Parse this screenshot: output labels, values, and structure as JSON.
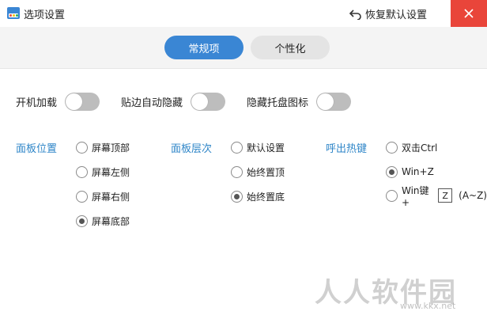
{
  "window": {
    "title": "选项设置",
    "restore_label": "恢复默认设置",
    "accent_color": "#3a86d4",
    "close_color": "#e9453a"
  },
  "tabs": [
    {
      "label": "常规项",
      "active": true
    },
    {
      "label": "个性化",
      "active": false
    }
  ],
  "toggles": [
    {
      "label": "开机加载",
      "on": false
    },
    {
      "label": "贴边自动隐藏",
      "on": false
    },
    {
      "label": "隐藏托盘图标",
      "on": false
    }
  ],
  "panel_position": {
    "label": "面板位置",
    "options": [
      {
        "label": "屏幕顶部",
        "selected": false
      },
      {
        "label": "屏幕左侧",
        "selected": false
      },
      {
        "label": "屏幕右侧",
        "selected": false
      },
      {
        "label": "屏幕底部",
        "selected": true
      }
    ]
  },
  "panel_layer": {
    "label": "面板层次",
    "options": [
      {
        "label": "默认设置",
        "selected": false
      },
      {
        "label": "始终置顶",
        "selected": false
      },
      {
        "label": "始终置底",
        "selected": true
      }
    ]
  },
  "hotkey": {
    "label": "呼出热键",
    "options": [
      {
        "label": "双击Ctrl",
        "selected": false
      },
      {
        "label": "Win+Z",
        "selected": true
      },
      {
        "label": "Win键+",
        "selected": false,
        "key": "Z",
        "suffix": "(A~Z)"
      }
    ]
  },
  "watermark": {
    "text": "人人软件园",
    "url": "www.kkx.net"
  }
}
